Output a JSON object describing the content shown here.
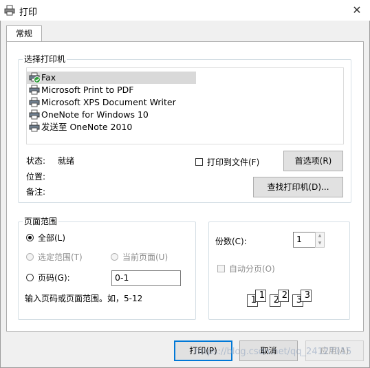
{
  "window": {
    "title": "打印",
    "close_glyph": "✕"
  },
  "tabs": [
    {
      "label": "常规"
    }
  ],
  "select_printer": {
    "legend": "选择打印机",
    "printers": [
      {
        "label": "Fax",
        "icon": "fax-printer-icon",
        "selected": true,
        "default": true
      },
      {
        "label": "Microsoft Print to PDF",
        "icon": "printer-icon"
      },
      {
        "label": "Microsoft XPS Document Writer",
        "icon": "printer-icon"
      },
      {
        "label": "OneNote for Windows 10",
        "icon": "printer-icon"
      },
      {
        "label": "发送至 OneNote 2010",
        "icon": "printer-icon"
      }
    ],
    "status_label": "状态:",
    "status_value": "就绪",
    "location_label": "位置:",
    "comment_label": "备注:",
    "print_to_file_label": "打印到文件(F)",
    "print_to_file_checked": false,
    "preferences_button": "首选项(R)",
    "find_printer_button": "查找打印机(D)..."
  },
  "page_range": {
    "legend": "页面范围",
    "all_label": "全部(L)",
    "selection_label": "选定范围(T)",
    "current_page_label": "当前页面(U)",
    "pages_label": "页码(G):",
    "pages_value": "0-1",
    "hint": "输入页码或页面范围。如，5-12",
    "selected_option": "all"
  },
  "copies": {
    "label": "份数(C):",
    "value": "1",
    "collate_label": "自动分页(O)",
    "collate_checked": false,
    "collate_digits": [
      "1",
      "1",
      "2",
      "2",
      "3",
      "3"
    ]
  },
  "footer": {
    "print_button": "打印(P)",
    "cancel_button": "取消",
    "apply_button": "应用(A)"
  },
  "watermark": "https://blog.csdn.net/qq_24127015",
  "colors": {
    "default_button_border": "#0078d7",
    "group_border": "#d5dfe5"
  }
}
